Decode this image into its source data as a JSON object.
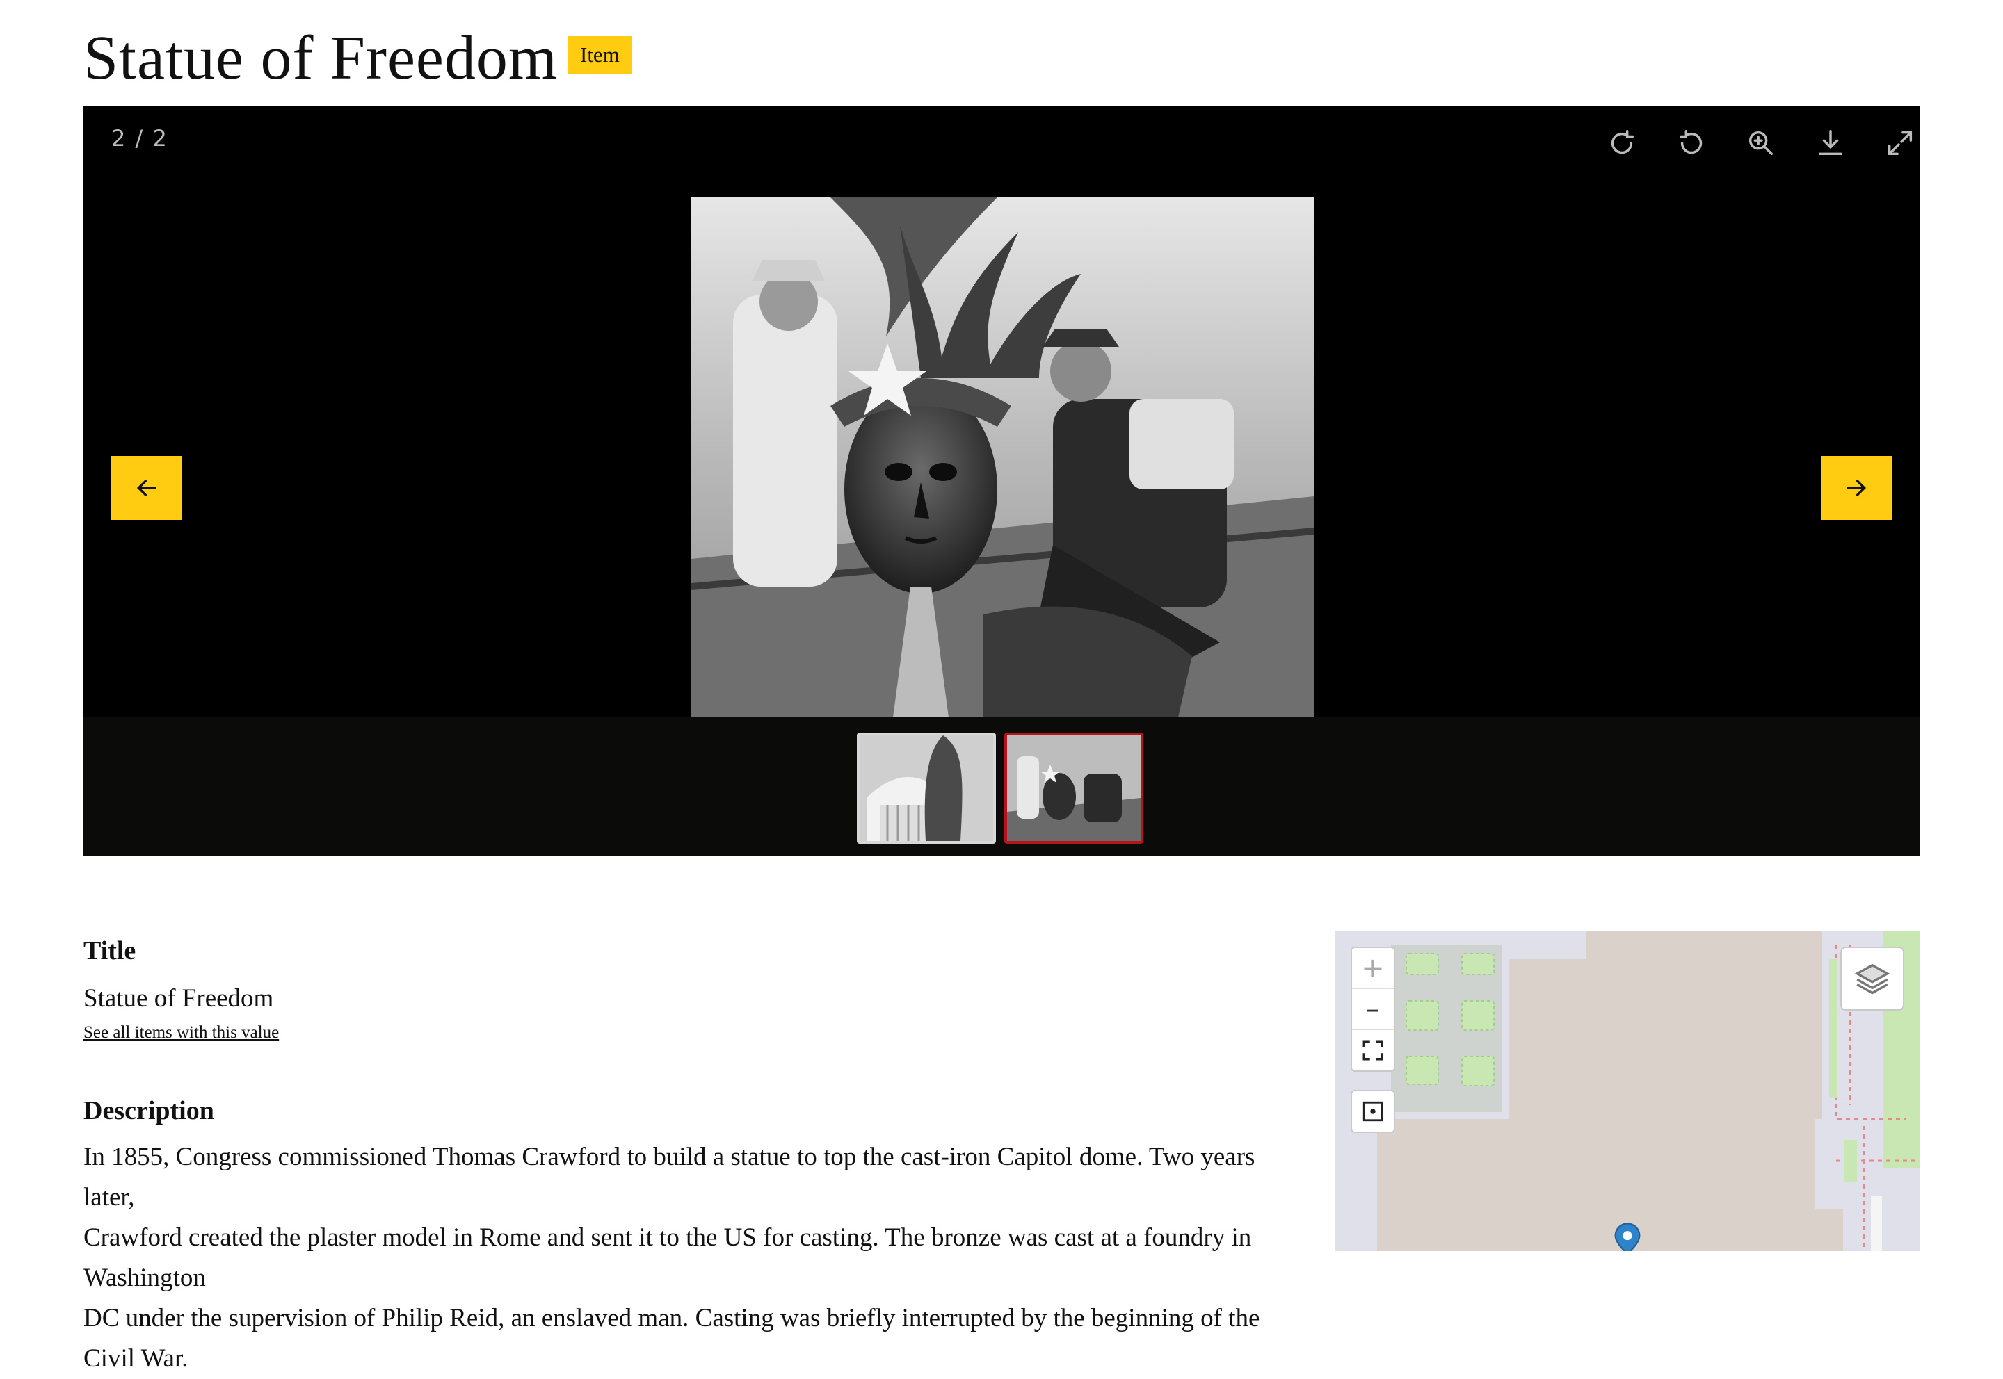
{
  "page": {
    "title": "Statue of Freedom",
    "type_badge": "Item"
  },
  "viewer": {
    "counter": "2 / 2",
    "toolbar": [
      "rotate-right-icon",
      "rotate-left-icon",
      "zoom-in-icon",
      "download-icon",
      "fullscreen-icon"
    ],
    "current_image": 2,
    "total_images": 2,
    "thumbnails": [
      {
        "name": "thumbnail-statue-on-dome",
        "active": false
      },
      {
        "name": "thumbnail-statue-head-workers",
        "active": true
      }
    ],
    "prev_icon": "arrow-left-icon",
    "next_icon": "arrow-right-icon"
  },
  "metadata": {
    "title_label": "Title",
    "title_value": "Statue of Freedom",
    "see_all_link": "See all items with this value",
    "description_label": "Description",
    "description_lines": [
      "In 1855, Congress commissioned Thomas Crawford to build a statue to top the cast-iron Capitol dome. Two years later,",
      "Crawford created the plaster model in Rome and sent it to the US for casting. The bronze was cast at a foundry in Washington",
      "DC under the supervision of Philip Reid, an enslaved man. Casting was briefly interrupted by the beginning of the Civil War."
    ]
  },
  "map": {
    "zoom_in": "+",
    "zoom_out": "–",
    "controls": [
      "zoom-in-button",
      "zoom-out-button",
      "fullscreen-map-icon",
      "locate-icon",
      "layers-icon"
    ],
    "marker": "location-marker-icon"
  },
  "colors": {
    "accent": "#ffcc12",
    "active_thumb_border": "#b8121b",
    "viewer_bg": "#000000",
    "map_land": "#d9d1ca",
    "map_green": "#c9e7b2"
  }
}
